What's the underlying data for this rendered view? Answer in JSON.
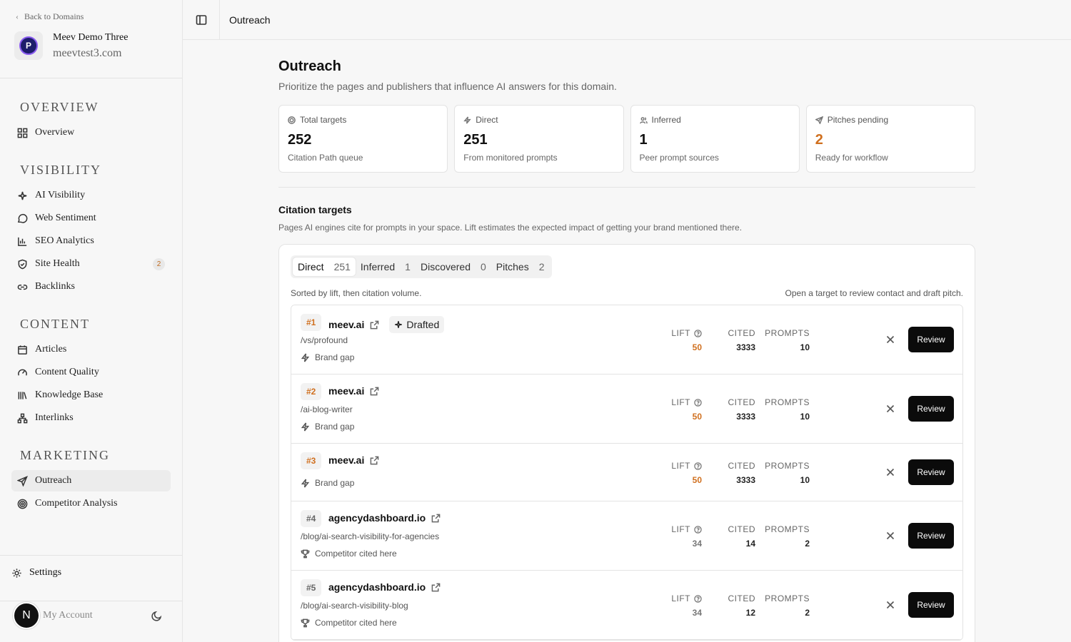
{
  "sidebar": {
    "back_label": "Back to Domains",
    "domain_name": "Meev Demo Three",
    "domain_url": "meevtest3.com",
    "logo_letter": "P",
    "sections": {
      "overview": "OVERVIEW",
      "visibility": "VISIBILITY",
      "content": "CONTENT",
      "marketing": "MARKETING"
    },
    "items": {
      "overview": "Overview",
      "ai_visibility": "AI Visibility",
      "web_sentiment": "Web Sentiment",
      "seo_analytics": "SEO Analytics",
      "site_health": "Site Health",
      "site_health_badge": "2",
      "backlinks": "Backlinks",
      "articles": "Articles",
      "content_quality": "Content Quality",
      "knowledge_base": "Knowledge Base",
      "interlinks": "Interlinks",
      "outreach": "Outreach",
      "competitor_analysis": "Competitor Analysis"
    },
    "settings": "Settings",
    "account_initial": "N",
    "account_label": "My Account"
  },
  "header": {
    "title": "Outreach"
  },
  "page": {
    "title": "Outreach",
    "subtitle": "Prioritize the pages and publishers that influence AI answers for this domain."
  },
  "stats": [
    {
      "label": "Total targets",
      "value": "252",
      "note": "Citation Path queue",
      "icon": "target-icon"
    },
    {
      "label": "Direct",
      "value": "251",
      "note": "From monitored prompts",
      "icon": "zap-icon"
    },
    {
      "label": "Inferred",
      "value": "1",
      "note": "Peer prompt sources",
      "icon": "users-icon"
    },
    {
      "label": "Pitches pending",
      "value": "2",
      "note": "Ready for workflow",
      "icon": "send-icon"
    }
  ],
  "citation": {
    "title": "Citation targets",
    "description": "Pages AI engines cite for prompts in your space. Lift estimates the expected impact of getting your brand mentioned there.",
    "tabs": [
      {
        "label": "Direct",
        "count": "251"
      },
      {
        "label": "Inferred",
        "count": "1"
      },
      {
        "label": "Discovered",
        "count": "0"
      },
      {
        "label": "Pitches",
        "count": "2"
      }
    ],
    "sort_note": "Sorted by lift, then citation volume.",
    "hint": "Open a target to review contact and draft pitch.",
    "metric_labels": {
      "lift": "LIFT",
      "cited": "CITED",
      "prompts": "PROMPTS"
    },
    "review_label": "Review",
    "drafted_label": "Drafted",
    "rows": [
      {
        "rank": "#1",
        "host": "meev.ai",
        "path": "/vs/profound",
        "tag": "Brand gap",
        "lift": "50",
        "cited": "3333",
        "prompts": "10"
      },
      {
        "rank": "#2",
        "host": "meev.ai",
        "path": "/ai-blog-writer",
        "tag": "Brand gap",
        "lift": "50",
        "cited": "3333",
        "prompts": "10"
      },
      {
        "rank": "#3",
        "host": "meev.ai",
        "path": "",
        "tag": "Brand gap",
        "lift": "50",
        "cited": "3333",
        "prompts": "10"
      },
      {
        "rank": "#4",
        "host": "agencydashboard.io",
        "path": "/blog/ai-search-visibility-for-agencies",
        "tag": "Competitor cited here",
        "lift": "34",
        "cited": "14",
        "prompts": "2"
      },
      {
        "rank": "#5",
        "host": "agencydashboard.io",
        "path": "/blog/ai-search-visibility-blog",
        "tag": "Competitor cited here",
        "lift": "34",
        "cited": "12",
        "prompts": "2"
      }
    ]
  },
  "colors": {
    "accent_orange": "#d0701f",
    "button_dark": "#0b0b0b"
  }
}
